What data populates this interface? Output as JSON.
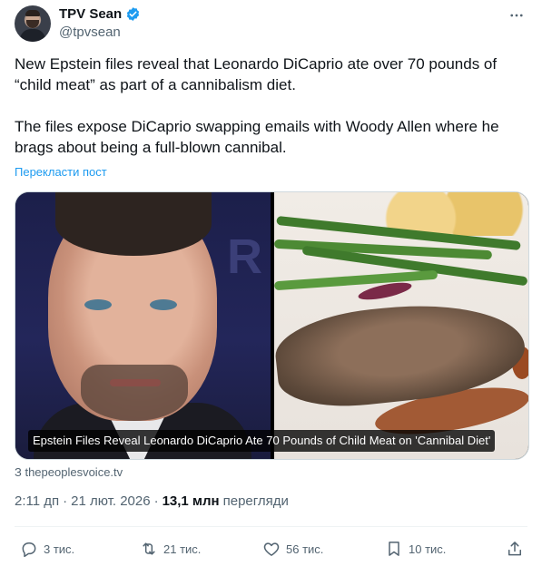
{
  "author": {
    "display_name": "TPV Sean",
    "handle": "@tpvsean",
    "verified": true
  },
  "post": {
    "paragraphs": [
      "New Epstein files reveal that Leonardo DiCaprio ate over 70 pounds of “child meat” as part of a cannibalism diet.",
      "The files expose DiCaprio swapping emails with Woody Allen where he brags about being a full-blown cannibal."
    ],
    "translate_label": "Перекласти пост"
  },
  "media": {
    "caption": "Epstein Files Reveal Leonardo DiCaprio Ate 70 Pounds of Child Meat on 'Cannibal Diet'",
    "source": "З thepeoplesvoice.tv"
  },
  "meta": {
    "time": "2:11 дп",
    "separator": "·",
    "date": "21 лют. 2026",
    "views_count": "13,1 млн",
    "views_label": "перегляди"
  },
  "actions": {
    "replies": "3 тис.",
    "reposts": "21 тис.",
    "likes": "56 тис.",
    "bookmarks": "10 тис."
  },
  "colors": {
    "accent": "#1d9bf0",
    "text": "#0f1419",
    "secondary": "#536471",
    "border": "#cfd9de"
  },
  "icons": [
    "more-icon",
    "verified-badge-icon",
    "reply-icon",
    "repost-icon",
    "like-icon",
    "bookmark-icon",
    "share-icon"
  ]
}
